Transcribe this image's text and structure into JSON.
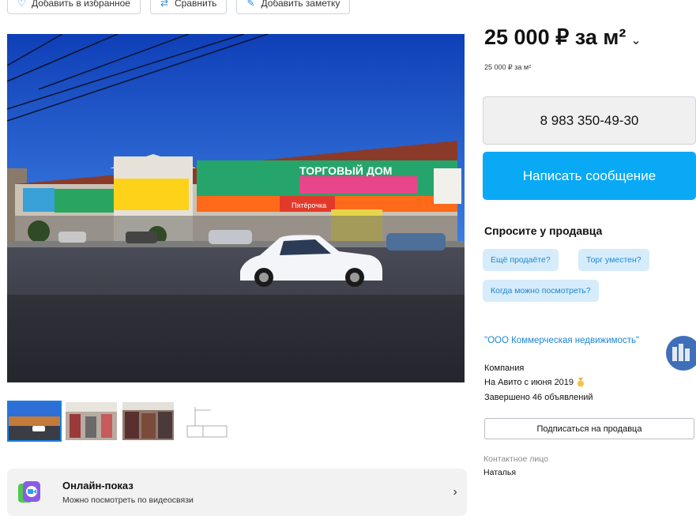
{
  "toolbar": {
    "favorite_label": "Добавить в избранное",
    "compare_label": "Сравнить",
    "note_label": "Добавить заметку"
  },
  "listing": {
    "price_main": "25 000 ₽ за м²",
    "price_sub": "25 000 ₽ за м²",
    "phone": "8 983 350-49-30",
    "message_label": "Написать сообщение"
  },
  "ask_seller": {
    "title": "Спросите у продавца",
    "chips": [
      "Ещё продаёте?",
      "Торг уместен?",
      "Когда можно посмотреть?"
    ]
  },
  "seller": {
    "name": "\"ООО Коммерческая недвижимость\"",
    "type": "Компания",
    "since": "На Авито с июня 2019",
    "completed": "Завершено 46 объявлений",
    "subscribe_label": "Подписаться на продавца"
  },
  "contact": {
    "label": "Контактное лицо",
    "name": "Наталья"
  },
  "online_show": {
    "title": "Онлайн-показ",
    "subtitle": "Можно посмотреть по видеосвязи"
  },
  "photo": {
    "sign_building": "ТОРГОВЫЙ ДОМ",
    "sign_store": "Пятёрочка"
  },
  "colors": {
    "accent_blue": "#0aa9f5",
    "link_blue": "#1a86d6",
    "chip_bg": "#d6ecfb"
  }
}
